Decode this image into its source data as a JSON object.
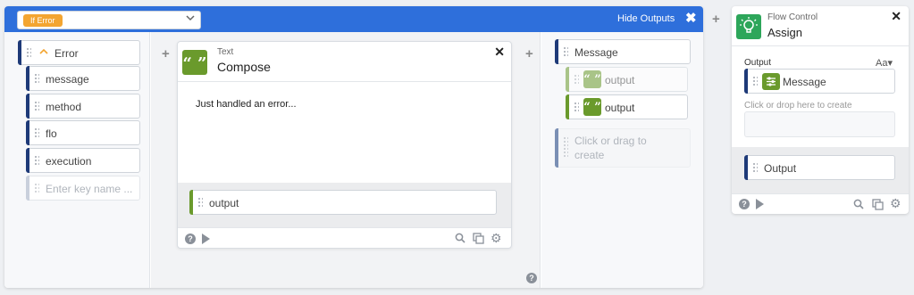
{
  "flow_header": {
    "step_tag": "If Error",
    "hide_outputs_label": "Hide Outputs",
    "close_glyph": "✖"
  },
  "error_column": {
    "root_field": "Error",
    "fields": [
      "message",
      "method",
      "flo",
      "execution"
    ],
    "new_key_placeholder": "Enter key name ..."
  },
  "compose_card": {
    "category": "Text",
    "title": "Compose",
    "body_text": "Just handled an error...",
    "output_label": "output",
    "icon_glyph": "“ ”"
  },
  "outputs_column": {
    "root_field": "Message",
    "items": [
      "output",
      "output"
    ],
    "drop_hint": "Click or drag to create"
  },
  "assign_panel": {
    "category": "Flow Control",
    "title": "Assign",
    "output_section_label": "Output",
    "text_format_label": "Aa▾",
    "message_field": "Message",
    "create_hint": "Click or drop here to create",
    "output_field": "Output"
  },
  "icons": {
    "help": "?",
    "gear": "⚙"
  },
  "colors": {
    "header_blue": "#2e6fdb",
    "tag_orange": "#f3a531",
    "text_green": "#6a9a2c",
    "flow_control_green": "#2da65a",
    "field_bar_navy": "#1e3a78"
  }
}
